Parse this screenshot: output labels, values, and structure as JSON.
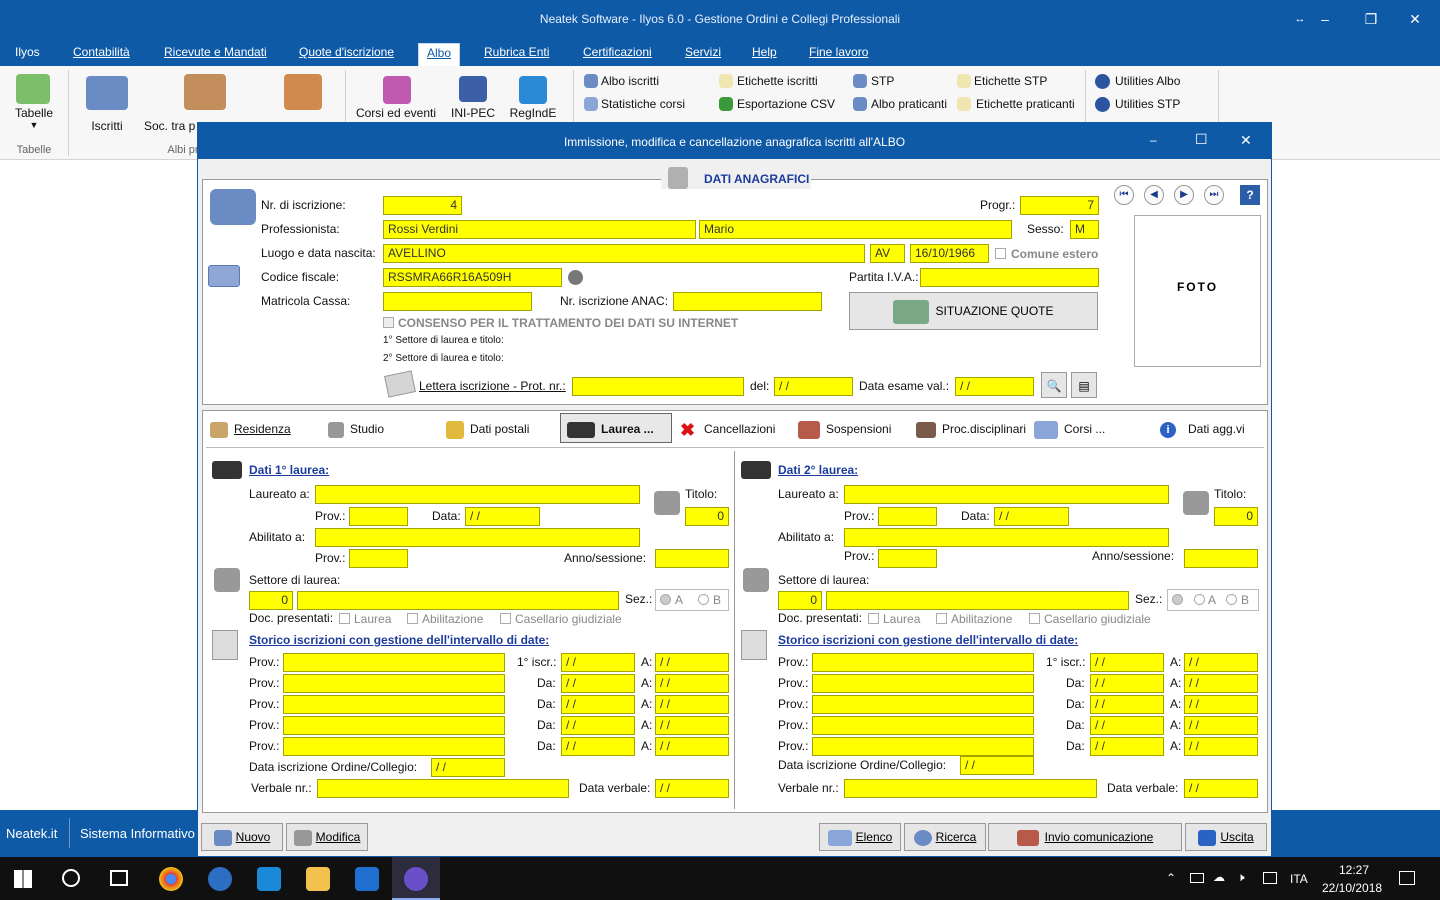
{
  "app": {
    "title": "Neatek Software - Ilyos 6.0 - Gestione Ordini e Collegi Professionali"
  },
  "menu": [
    "Ilyos",
    "Contabilità",
    "Ricevute e Mandati",
    "Quote d'iscrizione",
    "Albo",
    "Rubrica Enti",
    "Certificazioni",
    "Servizi",
    "Help",
    "Fine lavoro"
  ],
  "ribbon": {
    "tabelle": "Tabelle",
    "tabelle_group": "Tabelle",
    "iscritti": "Iscritti",
    "soc": "Soc. tra p",
    "albi_group": "Albi pr",
    "corsi": "Corsi ed eventi",
    "inipec": "INI-PEC",
    "regindE": "RegIndE",
    "small": [
      "Albo iscritti",
      "Statistiche corsi",
      "Etichette iscritti",
      "Esportazione CSV",
      "STP",
      "Albo praticanti",
      "Etichette STP",
      "Etichette praticanti",
      "Utilities Albo",
      "Utilities STP"
    ]
  },
  "status": {
    "left": "Neatek.it",
    "center": "Sistema Informativo"
  },
  "taskbar": {
    "lang": "ITA",
    "time": "12:27",
    "date": "22/10/2018"
  },
  "dialog": {
    "title": "Immissione, modifica e cancellazione anagrafica iscritti all'ALBO",
    "section": "DATI ANAGRAFICI",
    "labels": {
      "nr": "Nr. di iscrizione:",
      "prof": "Professionista:",
      "luogo": "Luogo e data nascita:",
      "cf": "Codice fiscale:",
      "matricola": "Matricola Cassa:",
      "anac": "Nr. iscrizione ANAC:",
      "progr": "Progr.:",
      "sesso": "Sesso:",
      "estero": "Comune estero",
      "piva": "Partita I.V.A.:",
      "consenso": "CONSENSO PER IL TRATTAMENTO DEI DATI SU INTERNET",
      "settore1": "1° Settore di laurea e titolo:",
      "settore2": "2° Settore di laurea e titolo:",
      "lettera": "Lettera iscrizione - Prot. nr.:",
      "del": "del:",
      "esame": "Data esame val.:",
      "situazione": "SITUAZIONE QUOTE",
      "foto": "FOTO"
    },
    "values": {
      "nr": "4",
      "cognome": "Rossi Verdini",
      "nome": "Mario",
      "luogo": "AVELLINO",
      "prov": "AV",
      "data_nascita": "16/10/1966",
      "cf": "RSSMRA66R16A509H",
      "progr": "7",
      "sesso": "M",
      "empty_date": "/ /"
    },
    "tabs": [
      "Residenza",
      "Studio",
      "Dati postali",
      "Laurea ...",
      "Cancellazioni",
      "Sospensioni",
      "Proc.disciplinari",
      "Corsi ...",
      "Dati agg.vi"
    ],
    "laurea": {
      "title1": "Dati 1° laurea:",
      "title2": "Dati 2° laurea:",
      "laureato": "Laureato a:",
      "prov": "Prov.:",
      "data": "Data:",
      "titolo": "Titolo:",
      "abilitato": "Abilitato a:",
      "anno": "Anno/sessione:",
      "settore": "Settore di laurea:",
      "sez": "Sez.:",
      "a": "A",
      "b": "B",
      "doc": "Doc. presentati:",
      "d_laurea": "Laurea",
      "d_abil": "Abilitazione",
      "d_cas": "Casellario giudiziale",
      "storico": "Storico iscrizioni con gestione dell'intervallo di date:",
      "prov_lbl": "Prov.:",
      "primo": "1° iscr.:",
      "da": "Da:",
      "a_lbl": "A:",
      "data_iscr": "Data iscrizione Ordine/Collegio:",
      "verbale": "Verbale nr.:",
      "data_verbale": "Data verbale:",
      "zero": "0"
    },
    "buttons": {
      "nuovo": "Nuovo",
      "modifica": "Modifica",
      "elenco": "Elenco",
      "ricerca": "Ricerca",
      "invio": "Invio comunicazione",
      "uscita": "Uscita"
    }
  }
}
